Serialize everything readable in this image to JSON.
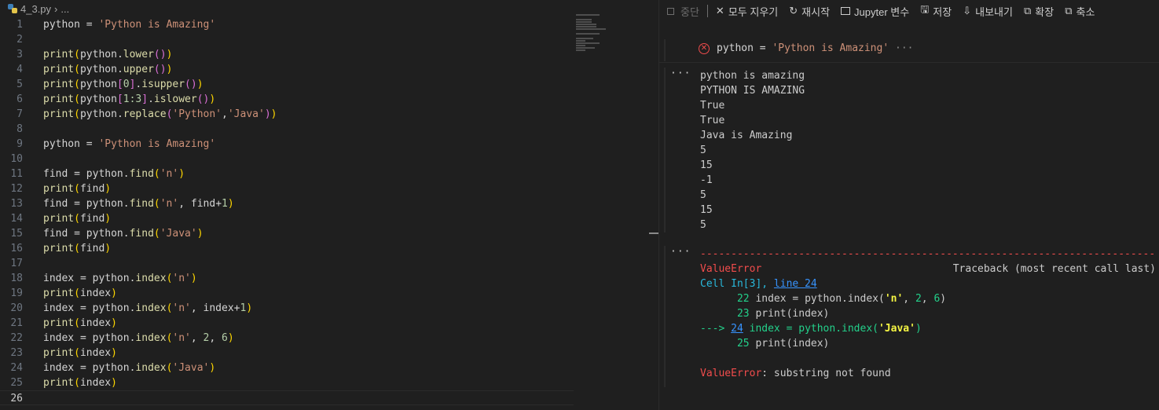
{
  "editor": {
    "breadcrumb": {
      "file": "4_3.py",
      "more": "..."
    },
    "lines": [
      {
        "n": "1"
      },
      {
        "n": "2"
      },
      {
        "n": "3"
      },
      {
        "n": "4"
      },
      {
        "n": "5"
      },
      {
        "n": "6"
      },
      {
        "n": "7"
      },
      {
        "n": "8"
      },
      {
        "n": "9"
      },
      {
        "n": "10"
      },
      {
        "n": "11"
      },
      {
        "n": "12"
      },
      {
        "n": "13"
      },
      {
        "n": "14"
      },
      {
        "n": "15"
      },
      {
        "n": "16"
      },
      {
        "n": "17"
      },
      {
        "n": "18"
      },
      {
        "n": "19"
      },
      {
        "n": "20"
      },
      {
        "n": "21"
      },
      {
        "n": "22"
      },
      {
        "n": "23"
      },
      {
        "n": "24"
      },
      {
        "n": "25"
      },
      {
        "n": "26"
      }
    ],
    "code": {
      "l1": [
        "python",
        " = ",
        "'Python is Amazing'"
      ],
      "l3": [
        "print",
        "(",
        "python",
        ".",
        "lower",
        "(",
        ")",
        ")"
      ],
      "l4": [
        "print",
        "(",
        "python",
        ".",
        "upper",
        "(",
        ")",
        ")"
      ],
      "l5": [
        "print",
        "(",
        "python",
        "[",
        "0",
        "]",
        ".",
        "isupper",
        "(",
        ")",
        ")"
      ],
      "l6": [
        "print",
        "(",
        "python",
        "[",
        "1:3",
        "]",
        ".",
        "islower",
        "(",
        ")",
        ")"
      ],
      "l7": [
        "print",
        "(",
        "python",
        ".",
        "replace",
        "(",
        "'Python'",
        ",",
        "'Java'",
        ")",
        ")"
      ],
      "l9": [
        "python",
        " = ",
        "'Python is Amazing'"
      ],
      "l11": [
        "find",
        " = ",
        "python",
        ".",
        "find",
        "(",
        "'n'",
        ")"
      ],
      "l12": [
        "print",
        "(",
        "find",
        ")"
      ],
      "l13": [
        "find",
        " = ",
        "python",
        ".",
        "find",
        "(",
        "'n'",
        ", ",
        "find",
        "+",
        "1",
        ")"
      ],
      "l14": [
        "print",
        "(",
        "find",
        ")"
      ],
      "l15": [
        "find",
        " = ",
        "python",
        ".",
        "find",
        "(",
        "'Java'",
        ")"
      ],
      "l16": [
        "print",
        "(",
        "find",
        ")"
      ],
      "l18": [
        "index",
        " = ",
        "python",
        ".",
        "index",
        "(",
        "'n'",
        ")"
      ],
      "l19": [
        "print",
        "(",
        "index",
        ")"
      ],
      "l20": [
        "index",
        " = ",
        "python",
        ".",
        "index",
        "(",
        "'n'",
        ", ",
        "index",
        "+",
        "1",
        ")"
      ],
      "l21": [
        "print",
        "(",
        "index",
        ")"
      ],
      "l22": [
        "index",
        " = ",
        "python",
        ".",
        "index",
        "(",
        "'n'",
        ", ",
        "2",
        ", ",
        "6",
        ")"
      ],
      "l23": [
        "print",
        "(",
        "index",
        ")"
      ],
      "l24": [
        "index",
        " = ",
        "python",
        ".",
        "index",
        "(",
        "'Java'",
        ")"
      ],
      "l25": [
        "print",
        "(",
        "index",
        ")"
      ]
    }
  },
  "toolbar": {
    "interrupt": "중단",
    "clear_all": "모두 지우기",
    "restart": "재시작",
    "variables": "Jupyter 변수",
    "save": "저장",
    "export": "내보내기",
    "expand": "확장",
    "collapse": "축소"
  },
  "cell": {
    "status_icon": "error-circle-icon",
    "source": [
      "python",
      " = ",
      "'Python is Amazing'"
    ],
    "ellipsis": "···"
  },
  "outputs": {
    "ellipsis": "···",
    "stdout": [
      "python is amazing",
      "PYTHON IS AMAZING",
      "True",
      "True",
      "Java is Amazing",
      "5",
      "15",
      "-1",
      "5",
      "15",
      "5"
    ],
    "traceback": {
      "dashes": "-----------------------------------------------------------------------------------------------------",
      "error_name": "ValueError",
      "header_right": "Traceback (most recent call last)",
      "cell_prefix": "Cell In[3], ",
      "cell_link": "line 24",
      "frames": [
        {
          "num": "22",
          "code": " index = python.index("
        },
        {
          "num": "23",
          "code": " print(index)"
        },
        {
          "num": "25",
          "code": " print(index)"
        }
      ],
      "frame22_args": [
        "'n'",
        ", ",
        "2",
        ", ",
        "6",
        ")"
      ],
      "arrow": "---> ",
      "arrow_num": "24",
      "arrow_code": " index = python.index(",
      "arrow_arg": "'Java'",
      "arrow_close": ")",
      "final_name": "ValueError",
      "final_msg": ": substring not found"
    }
  }
}
